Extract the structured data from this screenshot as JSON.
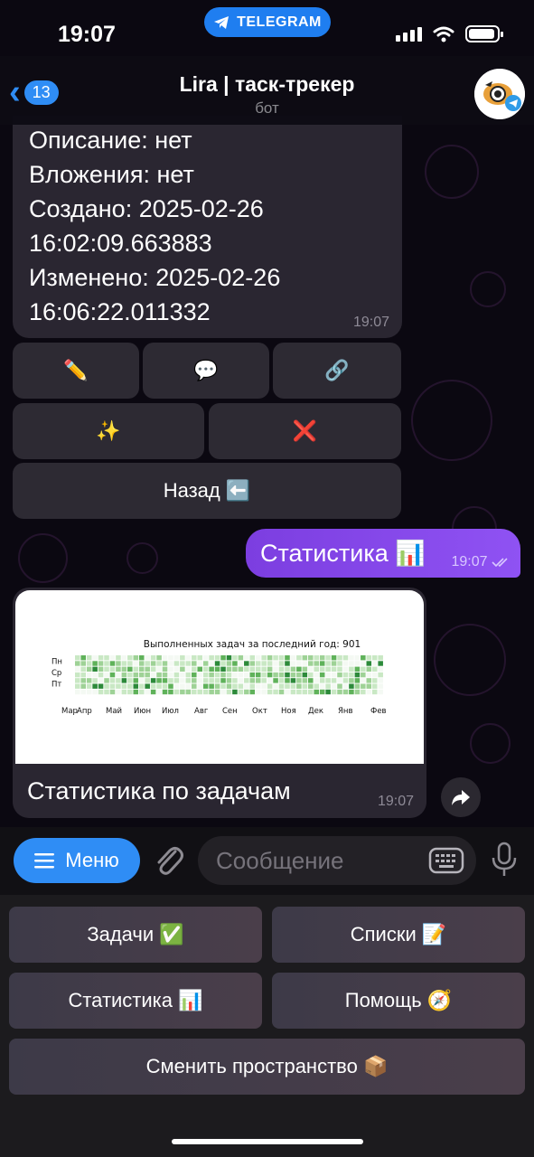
{
  "status": {
    "time": "19:07",
    "pill_label": "TELEGRAM"
  },
  "header": {
    "back_count": "13",
    "title": "Lira | таск-трекер",
    "subtitle": "бот"
  },
  "task_message": {
    "lines": [
      "Описание: нет",
      "Вложения: нет",
      "Создано: 2025-02-26",
      "16:02:09.663883",
      "Изменено: 2025-02-26",
      "16:06:22.011332"
    ],
    "time": "19:07"
  },
  "inline_buttons": {
    "row1": [
      "✏️",
      "💬",
      "🔗"
    ],
    "row2": [
      "✨",
      "❌"
    ],
    "back_label": "Назад ⬅️"
  },
  "outgoing": {
    "text": "Статистика 📊",
    "time": "19:07"
  },
  "stats_message": {
    "chart_title": "Выполненных задач за последний год: 901",
    "caption": "Статистика по задачам",
    "time": "19:07"
  },
  "chart_data": {
    "type": "heatmap",
    "title": "Выполненных задач за последний год: 901",
    "y_labels": [
      "Пн",
      "Ср",
      "Пт"
    ],
    "x_labels": [
      "Мар",
      "Апр",
      "Май",
      "Июн",
      "Июл",
      "Авг",
      "Сен",
      "Окт",
      "Ноя",
      "Дек",
      "Янв",
      "Фев"
    ],
    "rows": 7,
    "cols": 53,
    "colors": [
      "#f4f9f3",
      "#c9e8c4",
      "#9ed296",
      "#5fb25a",
      "#2c8a3a"
    ]
  },
  "input_bar": {
    "menu_label": "Меню",
    "placeholder": "Сообщение"
  },
  "reply_keyboard": {
    "tasks": "Задачи ✅",
    "lists": "Списки 📝",
    "stats": "Статистика 📊",
    "help": "Помощь 🧭",
    "switch_space": "Сменить пространство 📦"
  },
  "colors": {
    "accent": "#2f8df5",
    "outgoing": "#8a4ef0",
    "bubble": "#2a2631"
  }
}
